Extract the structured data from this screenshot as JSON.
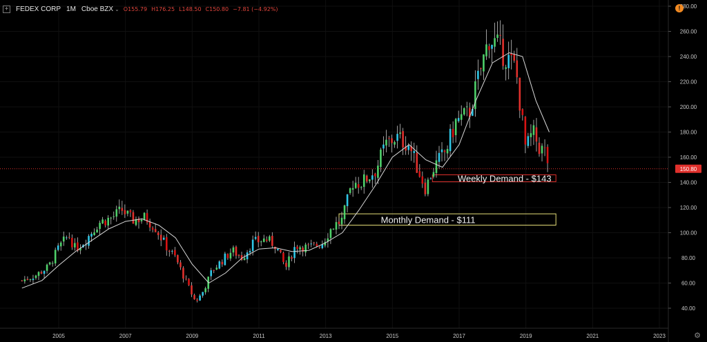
{
  "header": {
    "symbol": "FEDEX CORP",
    "timeframe": "1M",
    "exchange": "Cboe BZX",
    "open": "O155.79",
    "high": "H176.25",
    "low": "L148.50",
    "close": "C150.80",
    "change": "−7.81 (−4.92%)"
  },
  "icons": {
    "add": "plus-icon",
    "exchange_menu": "chevron-down-icon",
    "alert": "alert-icon",
    "settings": "gear-icon"
  },
  "colors": {
    "background": "#000000",
    "up": "#4fd16a",
    "down": "#e0302c",
    "up_alt": "#2fc7e6",
    "down_alt": "#d81414",
    "ma": "#d9d9d9",
    "price_line": "#e0302c",
    "weekly_zone": "#e0302c",
    "monthly_zone": "#e8e07a",
    "axis_text": "#c8c8c8",
    "grid": "#101010"
  },
  "chart_data": {
    "type": "candlestick",
    "xlabel": "",
    "ylabel": "",
    "xlim": [
      2003.9,
      2023.7
    ],
    "ylim": [
      33,
      283
    ],
    "y_ticks": [
      40,
      60,
      80,
      100,
      120,
      140,
      160,
      180,
      200,
      220,
      240,
      260,
      280
    ],
    "y_tick_labels": [
      "40.00",
      "60.00",
      "80.00",
      "100.00",
      "120.00",
      "140.00",
      "160.00",
      "180.00",
      "200.00",
      "220.00",
      "240.00",
      "260.00",
      "280.00"
    ],
    "x_ticks": [
      2005,
      2007,
      2009,
      2011,
      2013,
      2015,
      2017,
      2019,
      2021,
      2023
    ],
    "x_tick_labels": [
      "2005",
      "2007",
      "2009",
      "2011",
      "2013",
      "2015",
      "2017",
      "2019",
      "2021",
      "2023"
    ],
    "last_price": 150.8,
    "last_price_label": "150.80",
    "zones": [
      {
        "label": "Weekly Demand - $143",
        "x_start": 2016.2,
        "x_end": 2019.9,
        "y_low": 140.5,
        "y_high": 146
      },
      {
        "label": "Monthly Demand - $111",
        "x_start": 2013.4,
        "x_end": 2019.9,
        "y_low": 106,
        "y_high": 115
      }
    ],
    "anchors": [
      [
        2003.9,
        62
      ],
      [
        2004.3,
        66
      ],
      [
        2004.7,
        73
      ],
      [
        2005.0,
        88
      ],
      [
        2005.3,
        98
      ],
      [
        2005.5,
        87
      ],
      [
        2005.8,
        94
      ],
      [
        2006.2,
        108
      ],
      [
        2006.6,
        112
      ],
      [
        2006.9,
        118
      ],
      [
        2007.2,
        110
      ],
      [
        2007.6,
        112
      ],
      [
        2007.9,
        104
      ],
      [
        2008.2,
        90
      ],
      [
        2008.5,
        80
      ],
      [
        2008.8,
        62
      ],
      [
        2009.1,
        45
      ],
      [
        2009.3,
        52
      ],
      [
        2009.6,
        70
      ],
      [
        2009.9,
        78
      ],
      [
        2010.2,
        86
      ],
      [
        2010.5,
        80
      ],
      [
        2010.8,
        92
      ],
      [
        2011.2,
        95
      ],
      [
        2011.5,
        90
      ],
      [
        2011.8,
        72
      ],
      [
        2012.1,
        90
      ],
      [
        2012.5,
        88
      ],
      [
        2012.9,
        92
      ],
      [
        2013.2,
        105
      ],
      [
        2013.5,
        110
      ],
      [
        2013.8,
        140
      ],
      [
        2014.1,
        140
      ],
      [
        2014.5,
        150
      ],
      [
        2014.8,
        170
      ],
      [
        2015.1,
        176
      ],
      [
        2015.5,
        170
      ],
      [
        2015.7,
        155
      ],
      [
        2016.0,
        135
      ],
      [
        2016.2,
        150
      ],
      [
        2016.6,
        165
      ],
      [
        2016.9,
        188
      ],
      [
        2017.3,
        195
      ],
      [
        2017.6,
        225
      ],
      [
        2017.9,
        255
      ],
      [
        2018.1,
        250
      ],
      [
        2018.4,
        240
      ],
      [
        2018.7,
        230
      ],
      [
        2019.0,
        165
      ],
      [
        2019.2,
        180
      ],
      [
        2019.4,
        168
      ],
      [
        2019.6,
        163
      ],
      [
        2019.7,
        150.8
      ]
    ],
    "ma_anchors": [
      [
        2003.9,
        56
      ],
      [
        2004.5,
        62
      ],
      [
        2005.0,
        74
      ],
      [
        2005.5,
        85
      ],
      [
        2006.0,
        94
      ],
      [
        2006.5,
        103
      ],
      [
        2007.0,
        109
      ],
      [
        2007.5,
        111
      ],
      [
        2008.0,
        106
      ],
      [
        2008.5,
        96
      ],
      [
        2009.0,
        75
      ],
      [
        2009.5,
        60
      ],
      [
        2010.0,
        68
      ],
      [
        2010.5,
        80
      ],
      [
        2011.0,
        87
      ],
      [
        2011.5,
        88
      ],
      [
        2012.0,
        85
      ],
      [
        2012.5,
        86
      ],
      [
        2013.0,
        92
      ],
      [
        2013.5,
        100
      ],
      [
        2014.0,
        118
      ],
      [
        2014.5,
        138
      ],
      [
        2015.0,
        160
      ],
      [
        2015.5,
        170
      ],
      [
        2016.0,
        158
      ],
      [
        2016.5,
        152
      ],
      [
        2017.0,
        170
      ],
      [
        2017.5,
        205
      ],
      [
        2018.0,
        235
      ],
      [
        2018.5,
        243
      ],
      [
        2018.9,
        240
      ],
      [
        2019.3,
        205
      ],
      [
        2019.7,
        180
      ]
    ]
  }
}
